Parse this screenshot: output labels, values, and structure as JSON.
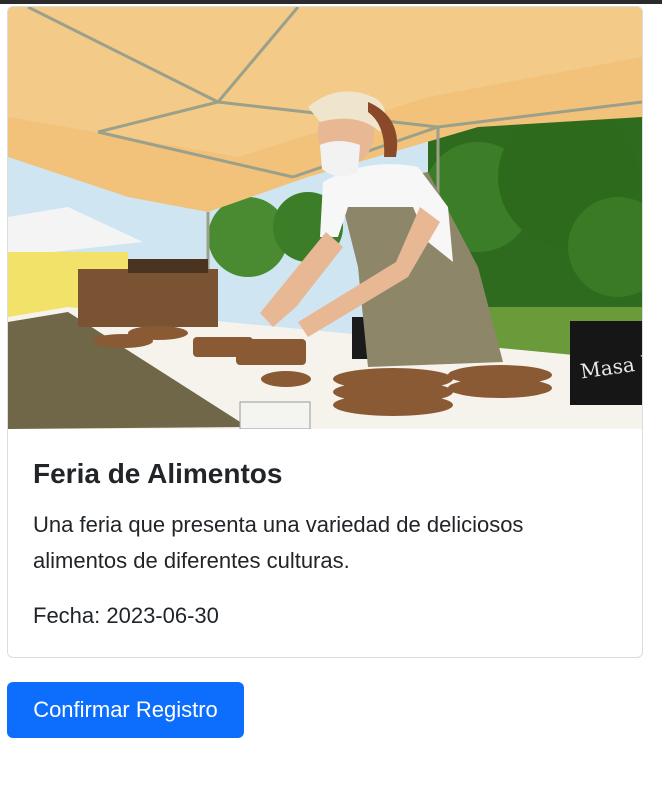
{
  "event": {
    "title": "Feria de Alimentos",
    "description": "Una feria que presenta una variedad de deliciosos alimentos de diferentes culturas.",
    "date": "Fecha: 2023-06-30",
    "image_sign": "Masa M"
  },
  "actions": {
    "confirm_label": "Confirmar Registro"
  },
  "colors": {
    "primary": "#0d6efd",
    "text": "#212529",
    "card_border": "#dcdcdc"
  }
}
